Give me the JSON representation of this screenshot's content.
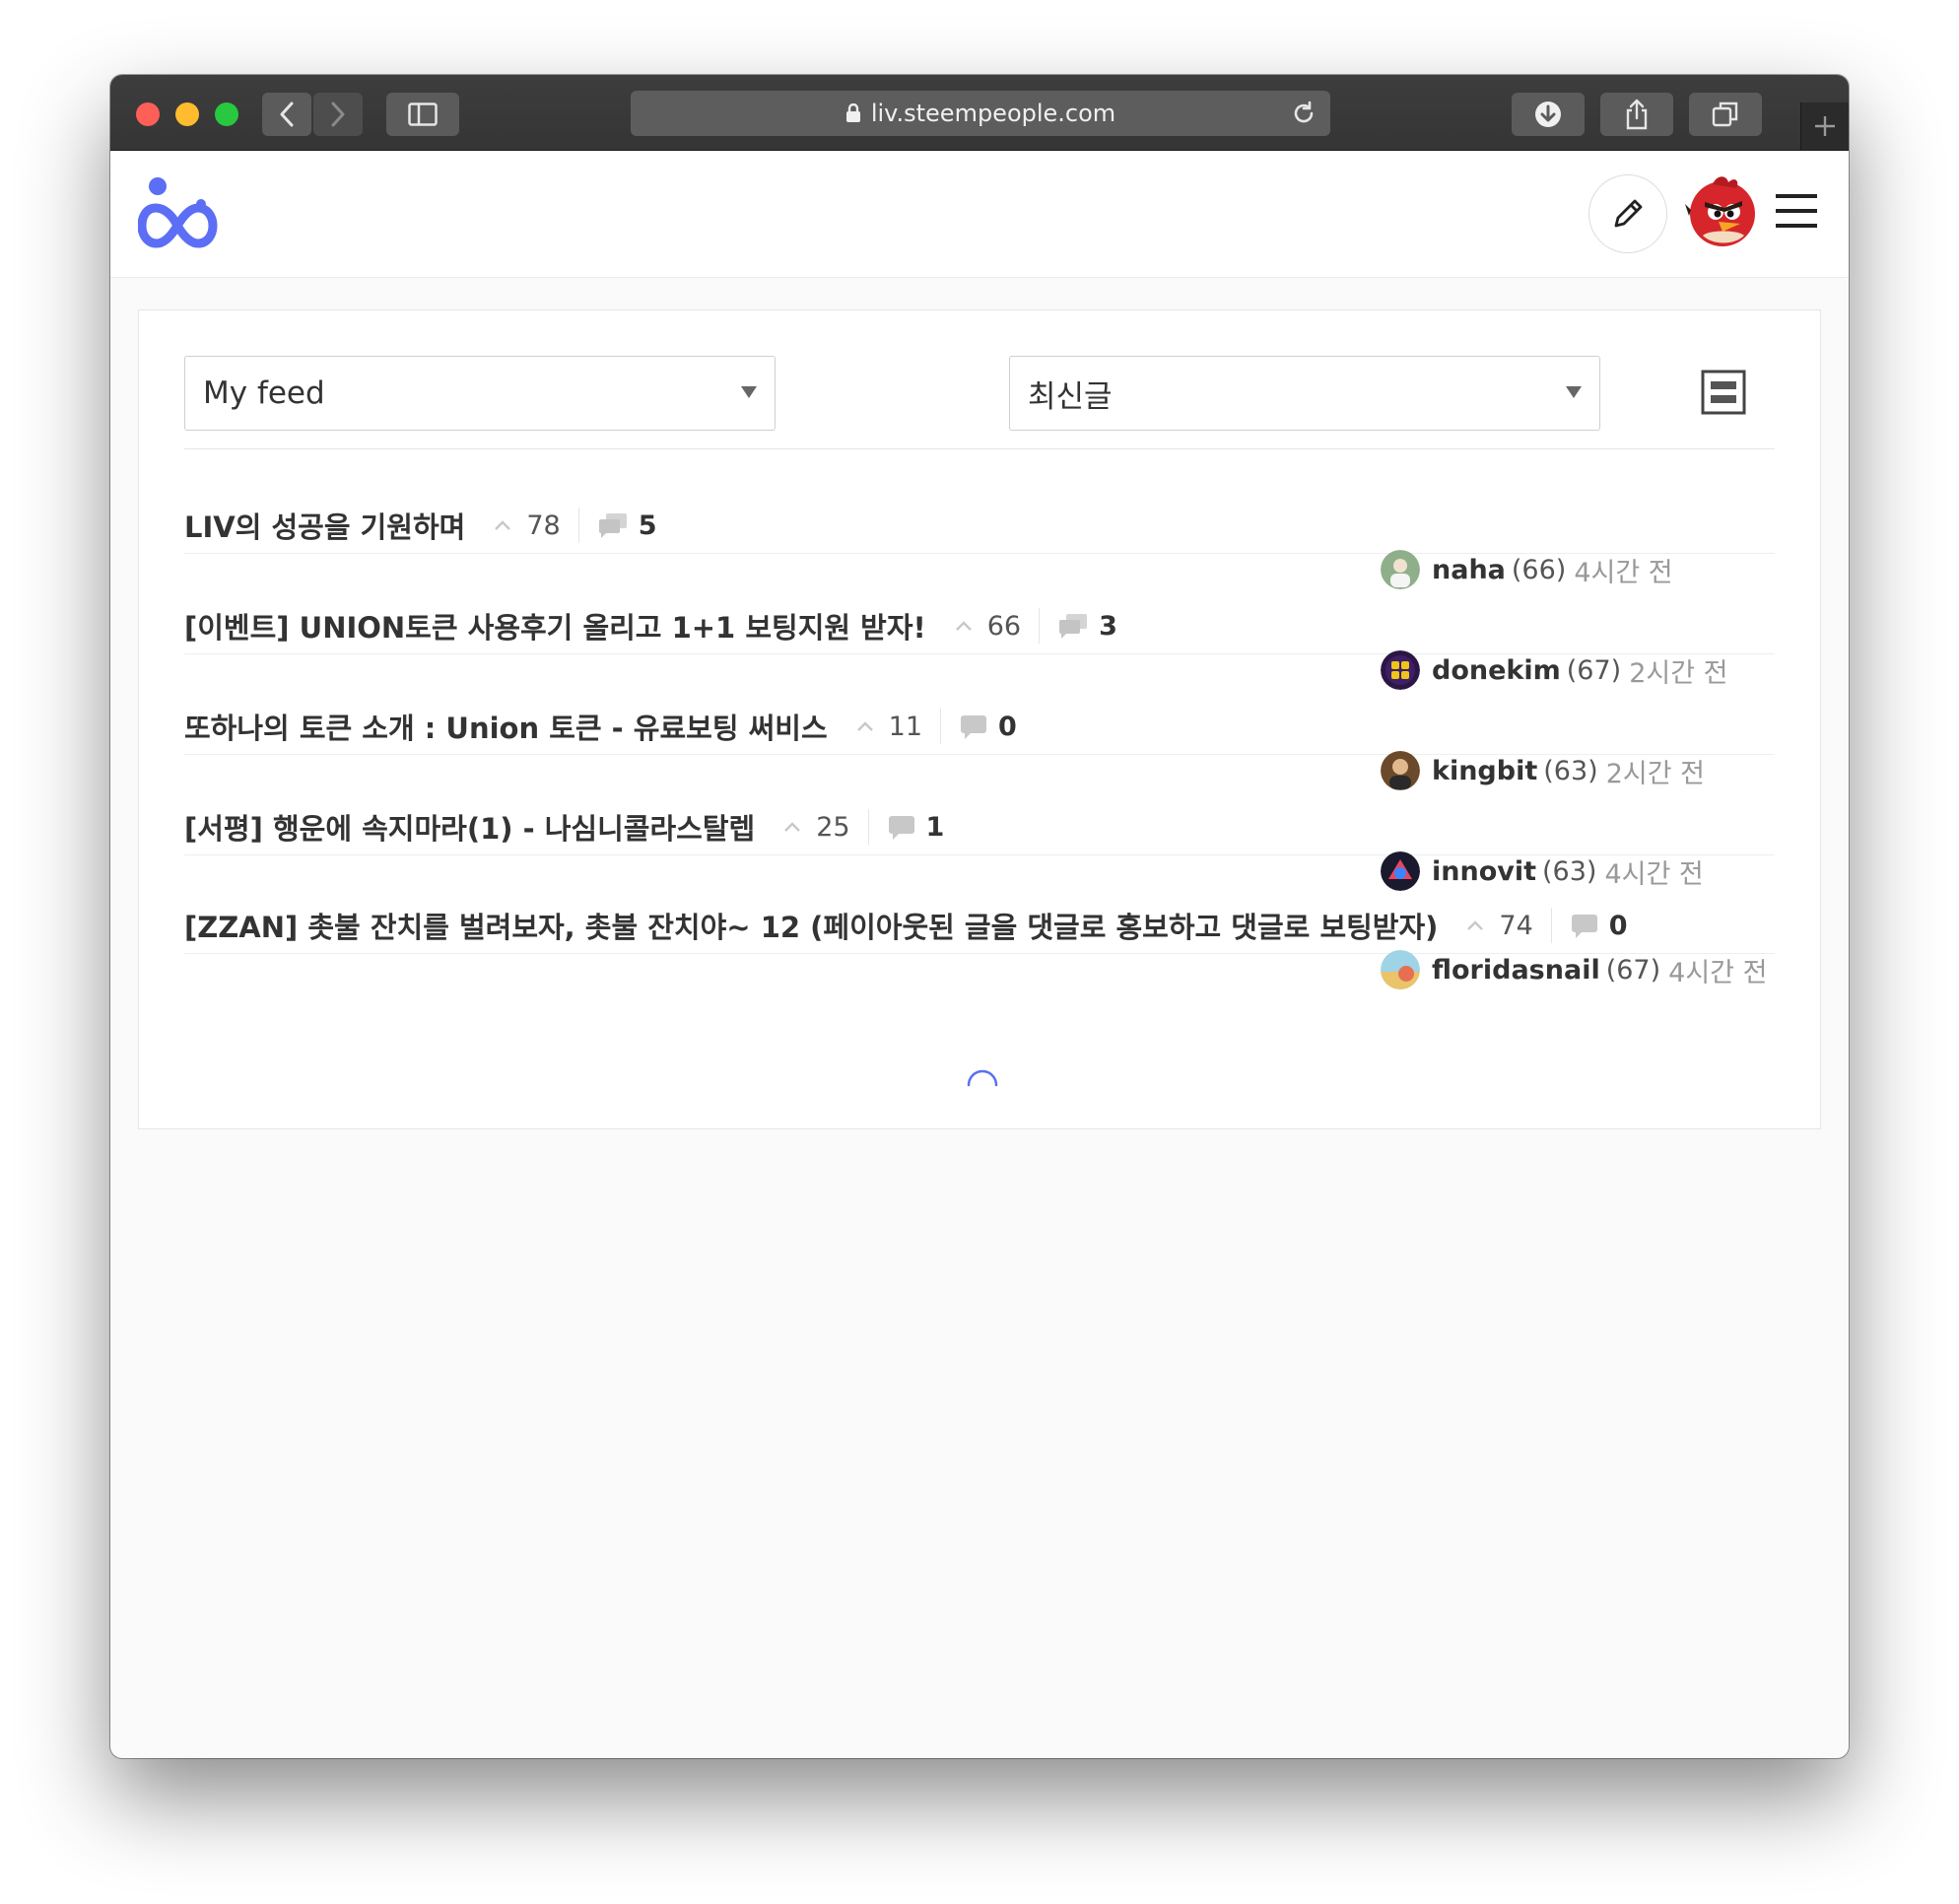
{
  "browser": {
    "url": "liv.steempeople.com"
  },
  "header": {
    "logo": "steempeople-logo",
    "write_icon": "pencil-icon",
    "avatar": "angry-bird-avatar",
    "menu_icon": "hamburger-icon"
  },
  "filters": {
    "feed_select": "My feed",
    "sort_select": "최신글"
  },
  "posts": [
    {
      "title": "LIV의 성공을 기원하며",
      "votes": "78",
      "comments": "5",
      "comment_icon": "double-comment-icon",
      "author": "naha",
      "reputation": "(66)",
      "time": "4시간 전"
    },
    {
      "title": "[이벤트] UNION토큰 사용후기 올리고 1+1 보팅지원 받자!",
      "votes": "66",
      "comments": "3",
      "comment_icon": "double-comment-icon",
      "author": "donekim",
      "reputation": "(67)",
      "time": "2시간 전"
    },
    {
      "title": "또하나의 토큰 소개 : Union 토큰 - 유료보팅 써비스",
      "votes": "11",
      "comments": "0",
      "comment_icon": "comment-icon",
      "author": "kingbit",
      "reputation": "(63)",
      "time": "2시간 전"
    },
    {
      "title": "[서평] 행운에 속지마라(1) - 나심니콜라스탈렙",
      "votes": "25",
      "comments": "1",
      "comment_icon": "comment-icon",
      "author": "innovit",
      "reputation": "(63)",
      "time": "4시간 전"
    },
    {
      "title": "[ZZAN] 촛불 잔치를 벌려보자, 촛불 잔치야~ 12 (페이아웃된 글을 댓글로 홍보하고 댓글로 보팅받자)",
      "votes": "74",
      "comments": "0",
      "comment_icon": "comment-icon",
      "author": "floridasnail",
      "reputation": "(67)",
      "time": "4시간 전"
    }
  ],
  "colors": {
    "brand": "#5b6ef5",
    "titlebar": "#3a3a3a"
  }
}
